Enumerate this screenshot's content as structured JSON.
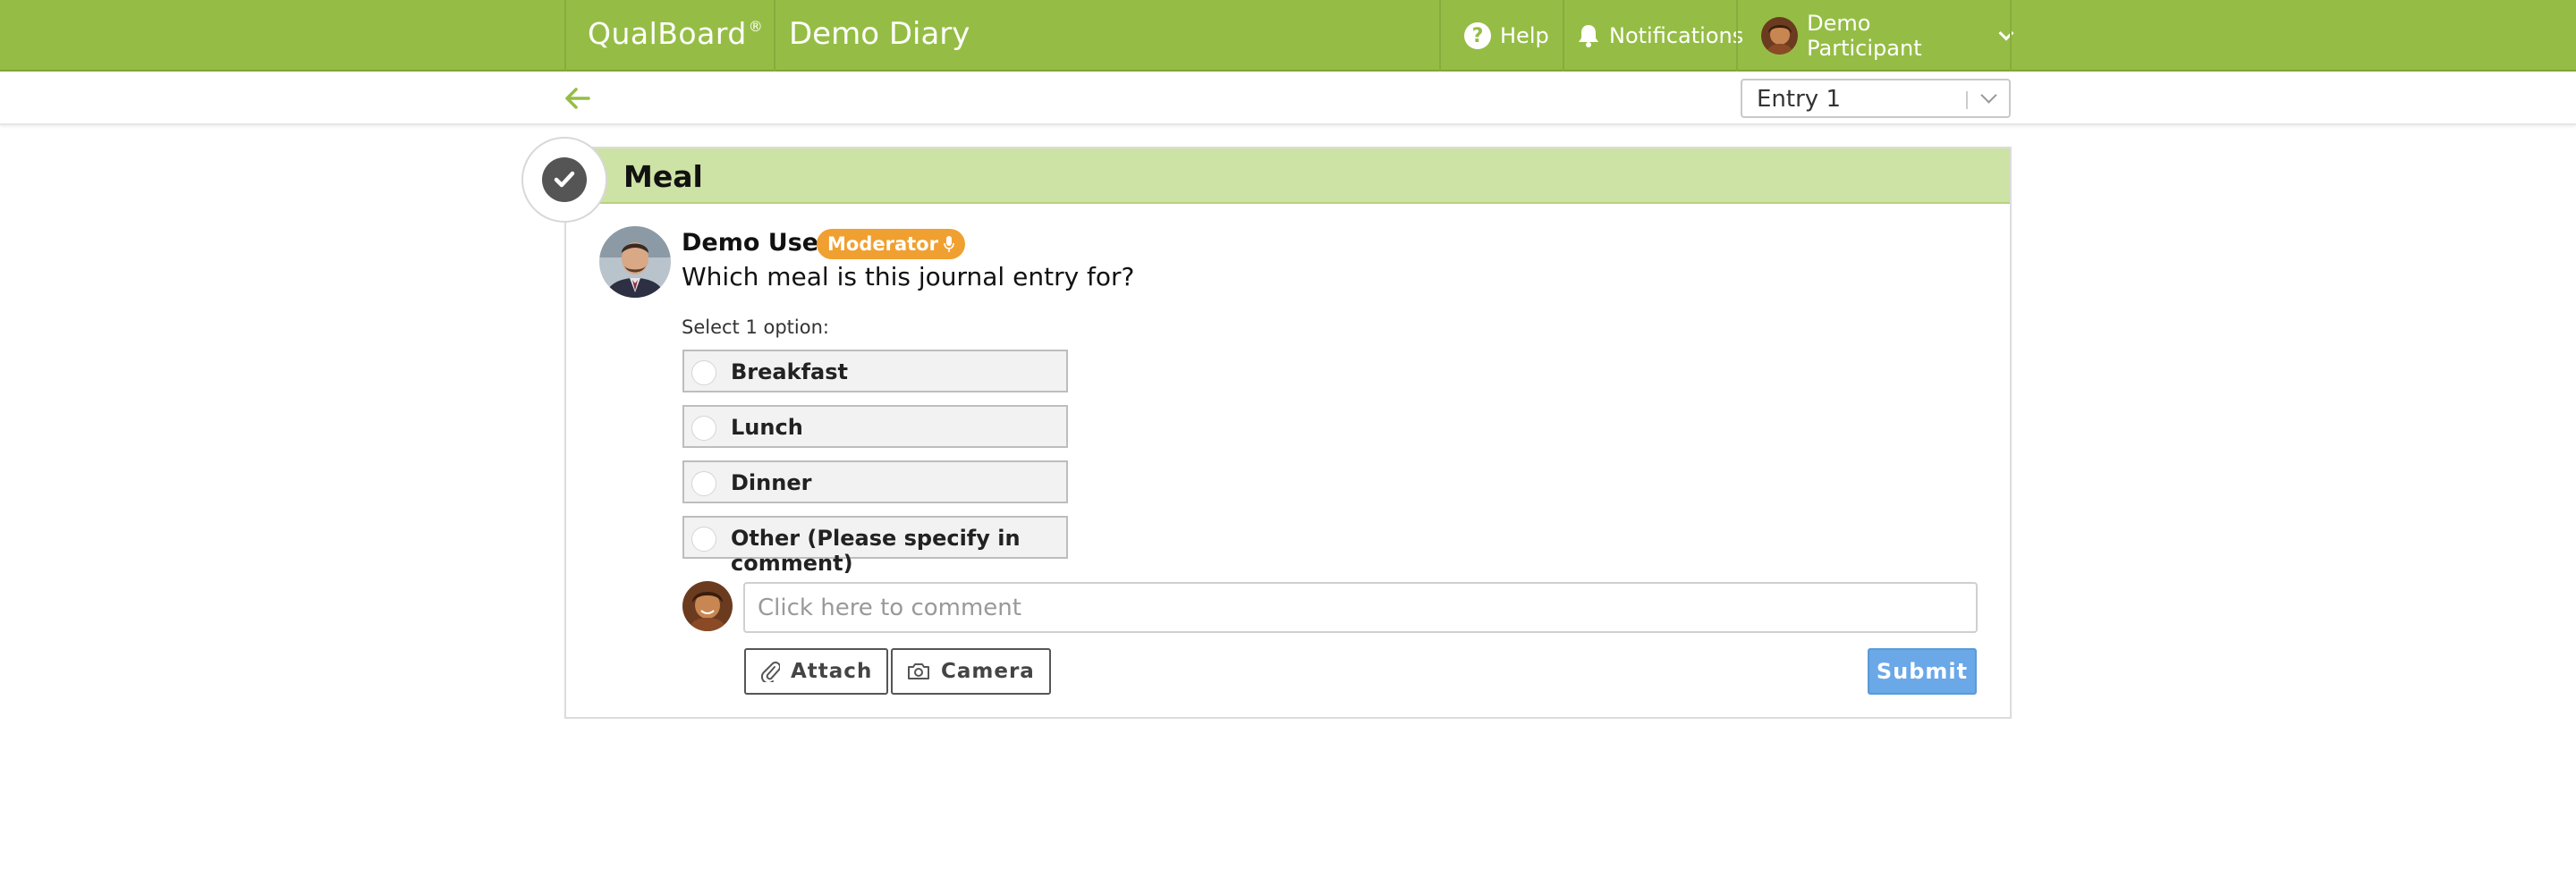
{
  "navbar": {
    "brand": "QualBoard",
    "brand_mark": "®",
    "project": "Demo Diary",
    "help_label": "Help",
    "notifications_label": "Notifications",
    "user_label": "Demo Participant"
  },
  "subbar": {
    "entry_value": "Entry 1"
  },
  "task": {
    "title": "Meal",
    "moderator_name": "Demo User",
    "moderator_badge": "Moderator",
    "question": "Which meal is this journal entry for?",
    "select_hint": "Select 1 option:",
    "options": [
      {
        "label": "Breakfast"
      },
      {
        "label": "Lunch"
      },
      {
        "label": "Dinner"
      },
      {
        "label": "Other (Please specify in comment)"
      }
    ]
  },
  "comment": {
    "placeholder": "Click here to comment",
    "attach_label": "Attach",
    "camera_label": "Camera",
    "submit_label": "Submit"
  },
  "colors": {
    "nav_green": "#95bd45",
    "header_green": "#cde2a5",
    "moderator_orange": "#f0a030",
    "submit_blue": "#6aa8e8"
  }
}
